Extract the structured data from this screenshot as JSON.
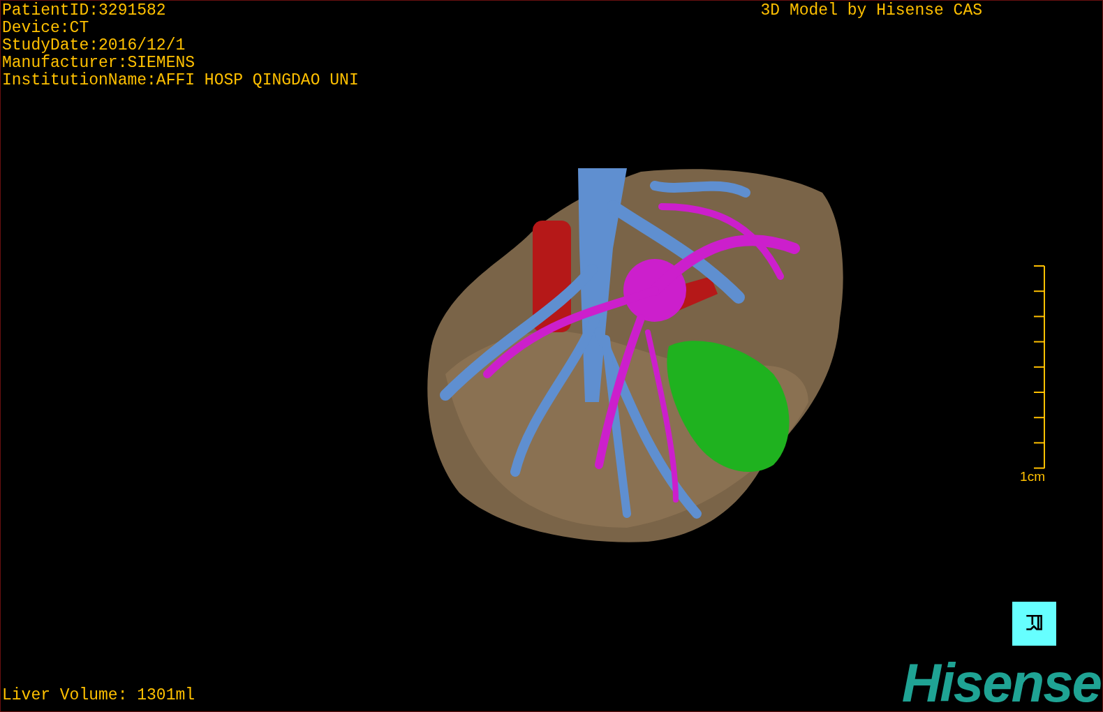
{
  "info_lines": [
    "PatientID:3291582",
    "Device:CT",
    "StudyDate:2016/12/1",
    "Manufacturer:SIEMENS",
    "InstitutionName:AFFI HOSP QINGDAO UNI"
  ],
  "title": "3D Model by Hisense CAS",
  "scale_bar": {
    "label": "1cm"
  },
  "liver_volume": "Liver Volume: 1301ml",
  "logo": "Hisense"
}
